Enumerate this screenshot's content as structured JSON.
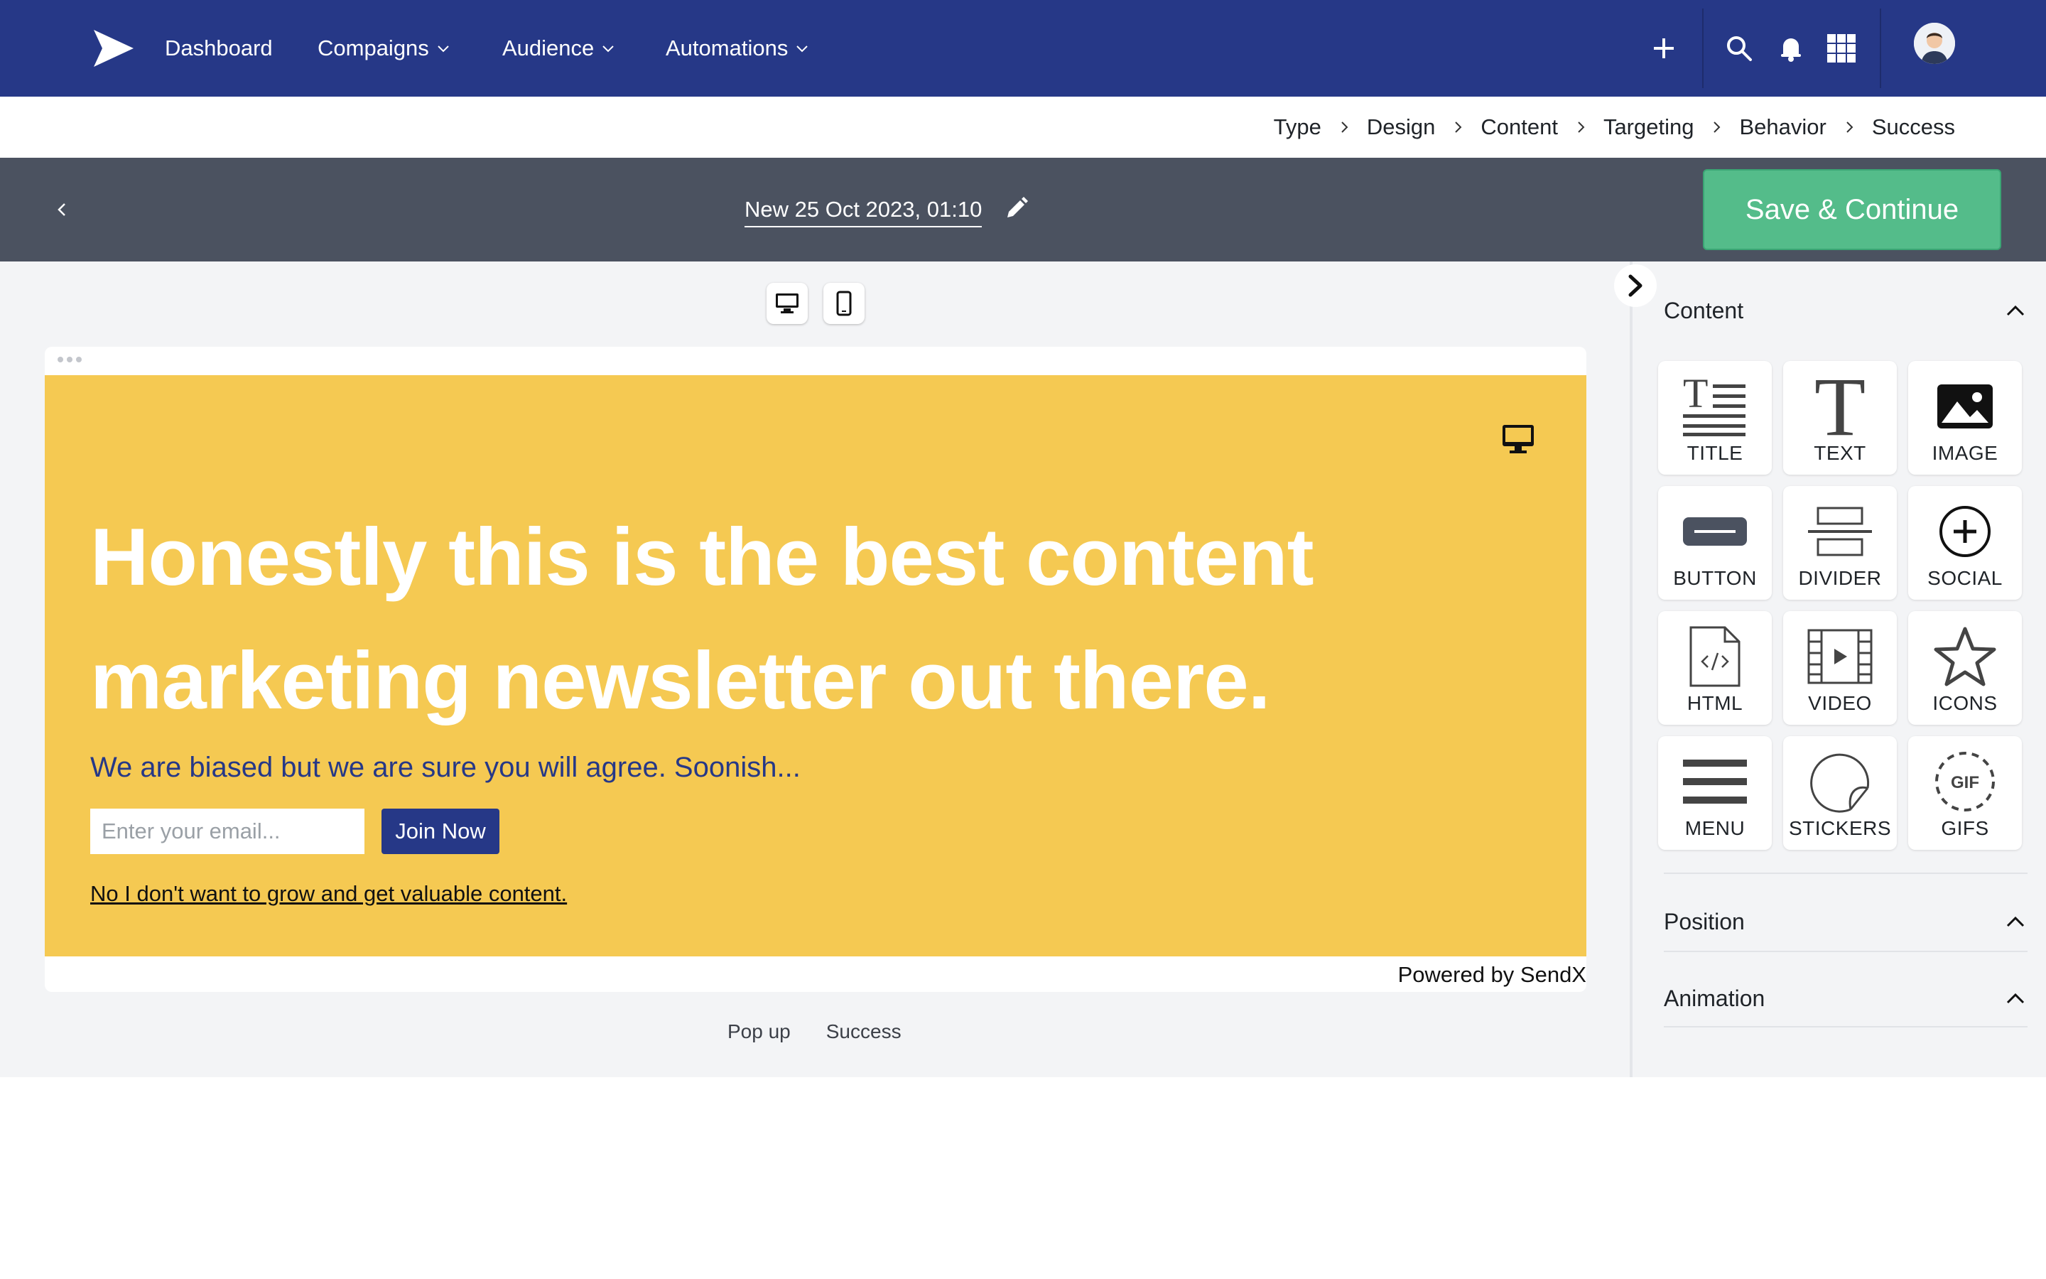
{
  "nav": {
    "items": [
      {
        "label": "Dashboard"
      },
      {
        "label": "Compaigns"
      },
      {
        "label": "Audience"
      },
      {
        "label": "Automations"
      }
    ],
    "icons": [
      "plus-icon",
      "search-icon",
      "bell-icon",
      "apps-grid-icon",
      "avatar"
    ]
  },
  "breadcrumb": [
    "Type",
    "Design",
    "Content",
    "Targeting",
    "Behavior",
    "Success"
  ],
  "editor": {
    "title": "New 25 Oct 2023, 01:10",
    "save_label": "Save & Continue"
  },
  "popup": {
    "headline": "Honestly this is the best content marketing newsletter out there.",
    "subline": "We are biased but we are sure you will agree. Soonish...",
    "email_placeholder": "Enter your email...",
    "join_label": "Join Now",
    "decline_label": "No I don't want to grow and get valuable content.",
    "powered_by": "Powered by SendX"
  },
  "page_tabs": [
    "Pop up",
    "Success"
  ],
  "panel": {
    "content_title": "Content",
    "tiles": [
      {
        "label": "TITLE",
        "icon": "title-icon"
      },
      {
        "label": "TEXT",
        "icon": "text-icon"
      },
      {
        "label": "IMAGE",
        "icon": "image-icon"
      },
      {
        "label": "BUTTON",
        "icon": "button-icon"
      },
      {
        "label": "DIVIDER",
        "icon": "divider-icon"
      },
      {
        "label": "SOCIAL",
        "icon": "social-icon"
      },
      {
        "label": "HTML",
        "icon": "html-icon"
      },
      {
        "label": "VIDEO",
        "icon": "video-icon"
      },
      {
        "label": "ICONS",
        "icon": "star-icon"
      },
      {
        "label": "MENU",
        "icon": "menu-icon"
      },
      {
        "label": "STICKERS",
        "icon": "sticker-icon"
      },
      {
        "label": "GIFS",
        "icon": "gif-icon"
      }
    ],
    "position_title": "Position",
    "animation_title": "Animation"
  },
  "colors": {
    "nav_bg": "#263887",
    "editor_bar_bg": "#4b5260",
    "save_green": "#54bc8a",
    "popup_yellow": "#f5c952",
    "brand_navy": "#263887"
  }
}
